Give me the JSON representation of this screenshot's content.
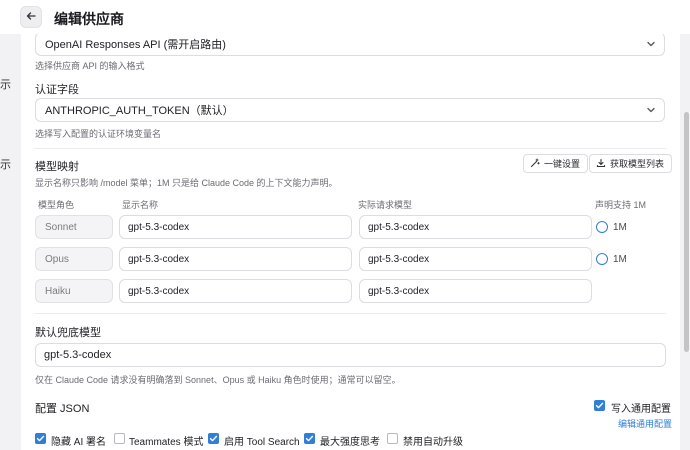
{
  "page": {
    "title": "编辑供应商",
    "side_glyphs": [
      "示",
      "示"
    ]
  },
  "api_format": {
    "value": "OpenAI Responses API (需开启路由)",
    "hint": "选择供应商 API 的输入格式"
  },
  "auth_field": {
    "label": "认证字段",
    "value": "ANTHROPIC_AUTH_TOKEN（默认）",
    "hint": "选择写入配置的认证环境变量名"
  },
  "model_mapping": {
    "title": "模型映射",
    "hint": "显示名称只影响 /model 菜单；1M 只是给 Claude Code 的上下文能力声明。",
    "one_click_label": "一键设置",
    "fetch_models_label": "获取模型列表",
    "columns": [
      "模型角色",
      "显示名称",
      "实际请求模型",
      "声明支持 1M"
    ],
    "rows": [
      {
        "role": "Sonnet",
        "display_name": "gpt-5.3-codex",
        "request_model": "gpt-5.3-codex",
        "one_m_label": "1M"
      },
      {
        "role": "Opus",
        "display_name": "gpt-5.3-codex",
        "request_model": "gpt-5.3-codex",
        "one_m_label": "1M"
      },
      {
        "role": "Haiku",
        "display_name": "gpt-5.3-codex",
        "request_model": "gpt-5.3-codex"
      }
    ]
  },
  "default_model": {
    "label": "默认兜底模型",
    "value": "gpt-5.3-codex",
    "hint": "仅在 Claude Code 请求没有明确落到 Sonnet、Opus 或 Haiku 角色时使用；通常可以留空。"
  },
  "config_json": {
    "label": "配置 JSON",
    "write_common_label": "写入通用配置",
    "write_common_checked": true,
    "edit_common_link": "编辑通用配置"
  },
  "options": [
    {
      "label": "隐藏 AI 署名",
      "checked": true
    },
    {
      "label": "Teammates 模式",
      "checked": false
    },
    {
      "label": "启用 Tool Search",
      "checked": true
    },
    {
      "label": "最大强度思考",
      "checked": true
    },
    {
      "label": "禁用自动升级",
      "checked": false
    }
  ],
  "colors": {
    "accent": "#2f7ed8",
    "border": "#dcdce1",
    "muted": "#6b6b73"
  },
  "icons": {
    "back": "arrow-left-icon",
    "chevron": "chevron-down-icon",
    "wand": "wand-icon",
    "download": "download-icon",
    "check": "check-icon"
  }
}
